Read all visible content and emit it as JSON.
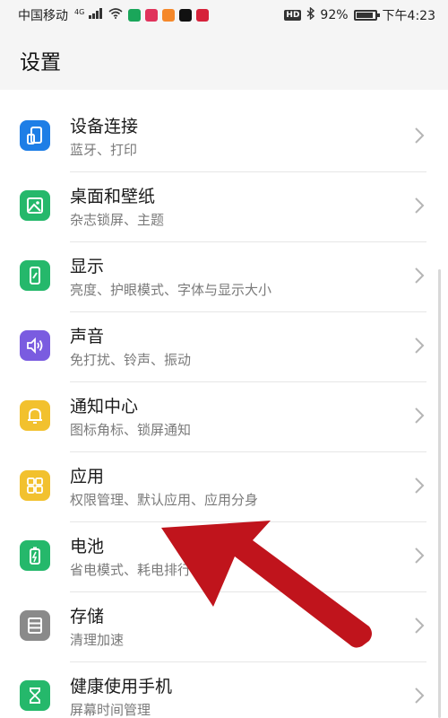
{
  "status_bar": {
    "carrier": "中国移动",
    "network": "4G",
    "battery_text": "92%",
    "battery_level": 0.92,
    "time": "下午4:23",
    "app_icons": [
      {
        "name": "video-app-icon",
        "color": "#1aa65a"
      },
      {
        "name": "gallery-app-icon",
        "color": "#e0335b"
      },
      {
        "name": "play-app-icon",
        "color": "#f5882a"
      },
      {
        "name": "tiktok-app-icon",
        "color": "#111111"
      },
      {
        "name": "tv-app-icon",
        "color": "#d6223a"
      }
    ]
  },
  "header": {
    "title": "设置"
  },
  "items": [
    {
      "title": "设备连接",
      "subtitle": "蓝牙、打印",
      "icon": "device-connection-icon",
      "color": "#1e7ee6"
    },
    {
      "title": "桌面和壁纸",
      "subtitle": "杂志锁屏、主题",
      "icon": "wallpaper-icon",
      "color": "#25b86b"
    },
    {
      "title": "显示",
      "subtitle": "亮度、护眼模式、字体与显示大小",
      "icon": "display-icon",
      "color": "#25b86b"
    },
    {
      "title": "声音",
      "subtitle": "免打扰、铃声、振动",
      "icon": "sound-icon",
      "color": "#7a5ce0"
    },
    {
      "title": "通知中心",
      "subtitle": "图标角标、锁屏通知",
      "icon": "notification-bell-icon",
      "color": "#f2c12e"
    },
    {
      "title": "应用",
      "subtitle": "权限管理、默认应用、应用分身",
      "icon": "apps-grid-icon",
      "color": "#f2c12e"
    },
    {
      "title": "电池",
      "subtitle": "省电模式、耗电排行",
      "icon": "battery-icon",
      "color": "#25b86b"
    },
    {
      "title": "存储",
      "subtitle": "清理加速",
      "icon": "storage-icon",
      "color": "#8a8a8a"
    },
    {
      "title": "健康使用手机",
      "subtitle": "屏幕时间管理",
      "icon": "hourglass-icon",
      "color": "#25b86b"
    }
  ],
  "annotation": {
    "arrow_color": "#c0141c"
  }
}
